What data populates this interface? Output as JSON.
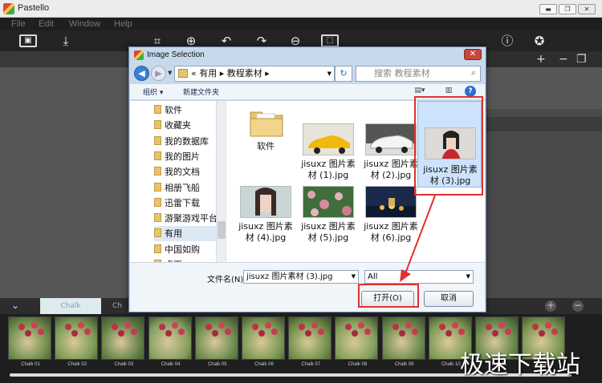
{
  "app": {
    "title": "Pastello"
  },
  "window_controls": {
    "minimize": "▬",
    "maximize": "❐",
    "close": "✕"
  },
  "menu": [
    "File",
    "Edit",
    "Window",
    "Help"
  ],
  "toolbar_right": {
    "add": "+",
    "minus": "−",
    "copy": "❐"
  },
  "bottom_tabs": {
    "active": "Chalk",
    "next": "Ch"
  },
  "thumbnails": [
    "Chalk 01",
    "Chalk 02",
    "Chalk 03",
    "Chalk 04",
    "Chalk 05",
    "Chalk 06",
    "Chalk 07",
    "Chalk 08",
    "Chalk 09",
    "Chalk 10",
    "Chalk 11",
    "Chalk 13"
  ],
  "dialog": {
    "title": "Image Selection",
    "close": "✕",
    "address": {
      "path": "« 有用 ▸ 教程素材 ▸",
      "refresh": "↻"
    },
    "search_placeholder": "搜索 教程素材",
    "organize": "组织 ▾",
    "new_folder": "新建文件夹",
    "help": "?",
    "nav_items": [
      "软件",
      "收藏夹",
      "我的数据库",
      "我的图片",
      "我的文档",
      "相册飞船",
      "迅雷下载",
      "游聚游戏平台",
      "有用",
      "中国如购",
      "桌面"
    ],
    "nav_selected": "有用",
    "files": [
      {
        "name": "软件"
      },
      {
        "name": "jisuxz 图片素材 (1).jpg"
      },
      {
        "name": "jisuxz 图片素材 (2).jpg"
      },
      {
        "name": "jisuxz 图片素材 (3).jpg"
      },
      {
        "name": "jisuxz 图片素材 (4).jpg"
      },
      {
        "name": "jisuxz 图片素材 (5).jpg"
      },
      {
        "name": "jisuxz 图片素材 (6).jpg"
      }
    ],
    "filename_label": "文件名(N):",
    "filename_value": "jisuxz 图片素材 (3).jpg",
    "filetype_value": "All",
    "open_button": "打开(O)",
    "cancel_button": "取消"
  },
  "watermark": "极速下载站",
  "colors": {
    "highlight": "#e03030",
    "selected_file_bg": "#cde3fb",
    "dialog_frame": "#c7d9ec"
  }
}
